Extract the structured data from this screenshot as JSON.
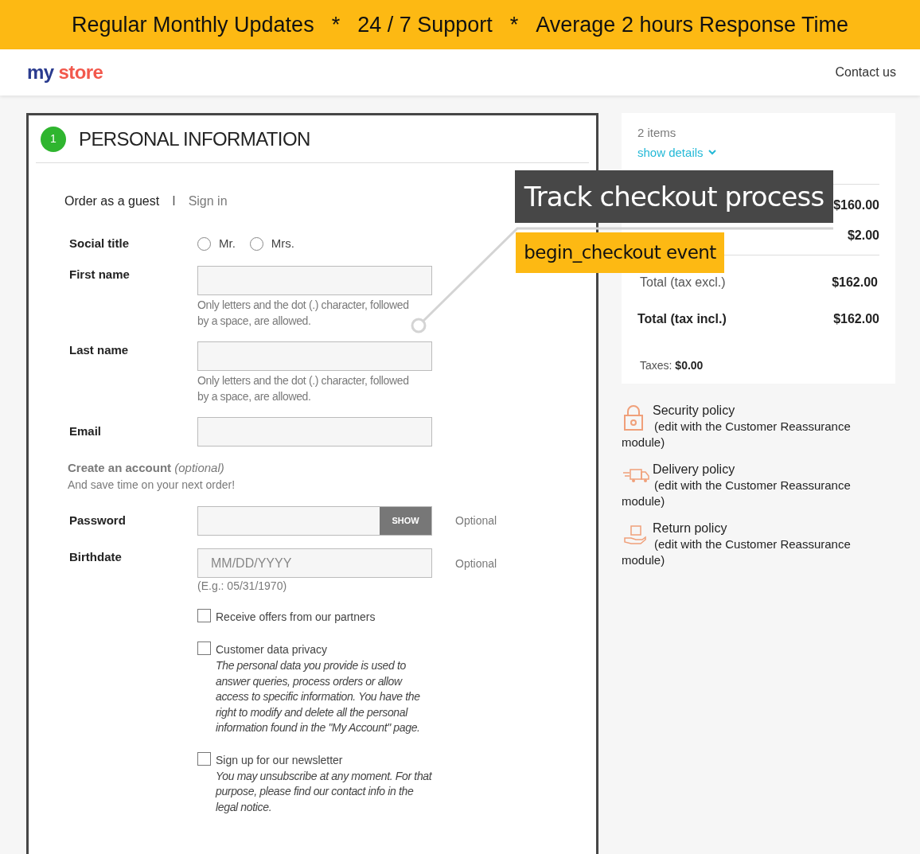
{
  "banner": {
    "items": [
      "Regular Monthly Updates",
      "*",
      "24 / 7 Support",
      "*",
      "Average 2 hours Response Time"
    ]
  },
  "header": {
    "logo": {
      "first": "my",
      "second": "store"
    },
    "contact": "Contact us"
  },
  "form": {
    "step": "1",
    "title": "PERSONAL INFORMATION",
    "modes": [
      {
        "label": "Order as a guest",
        "selected": true
      },
      {
        "label": "Sign in",
        "selected": false
      }
    ],
    "separator": "I",
    "social_title": {
      "label": "Social title",
      "options": [
        {
          "label": "Mr.",
          "selected": false
        },
        {
          "label": "Mrs.",
          "selected": false
        }
      ]
    },
    "first_name": {
      "label": "First name",
      "help": "Only letters and the dot (.) character, followed by a space, are allowed."
    },
    "last_name": {
      "label": "Last name",
      "help": "Only letters and the dot (.) character, followed by a space, are allowed."
    },
    "email": {
      "label": "Email"
    },
    "create_account": {
      "title": "Create an account",
      "optional": "(optional)",
      "subtitle": "And save time on your next order!"
    },
    "password": {
      "label": "Password",
      "button": "SHOW",
      "note": "Optional"
    },
    "birthdate": {
      "label": "Birthdate",
      "placeholder": "MM/DD/YYYY",
      "note": "Optional",
      "example": "(E.g.: 05/31/1970)"
    },
    "checkboxes": [
      {
        "label": "Receive offers from our partners",
        "checked": false
      },
      {
        "label": "Customer data privacy",
        "checked": false,
        "description": "The personal data you provide is used to answer queries, process orders or allow access to specific information. You have the right to modify and delete all the personal information found in the \"My Account\" page."
      },
      {
        "label": "Sign up for our newsletter",
        "checked": false,
        "description": "You may unsubscribe at any moment. For that purpose, please find our contact info in the legal notice."
      }
    ]
  },
  "summary": {
    "items_count": "2 items",
    "show_details": "show details",
    "subtotal": "$160.00",
    "shipping": "$2.00",
    "total_excl": {
      "label": "Total (tax excl.)",
      "value": "$162.00"
    },
    "total_incl": {
      "label": "Total (tax incl.)",
      "value": "$162.00"
    },
    "taxes": {
      "label": "Taxes:",
      "value": "$0.00"
    }
  },
  "reassurance": [
    {
      "kind": "lock",
      "title": "Security policy",
      "text": "(edit with the Customer Reassurance module)"
    },
    {
      "kind": "truck",
      "title": "Delivery policy",
      "text": "(edit with the Customer Reassurance module)"
    },
    {
      "kind": "hand",
      "title": "Return policy",
      "text": "(edit with the Customer Reassurance module)"
    }
  ],
  "annotation": {
    "title": "Track checkout process",
    "event": "begin_checkout event"
  }
}
